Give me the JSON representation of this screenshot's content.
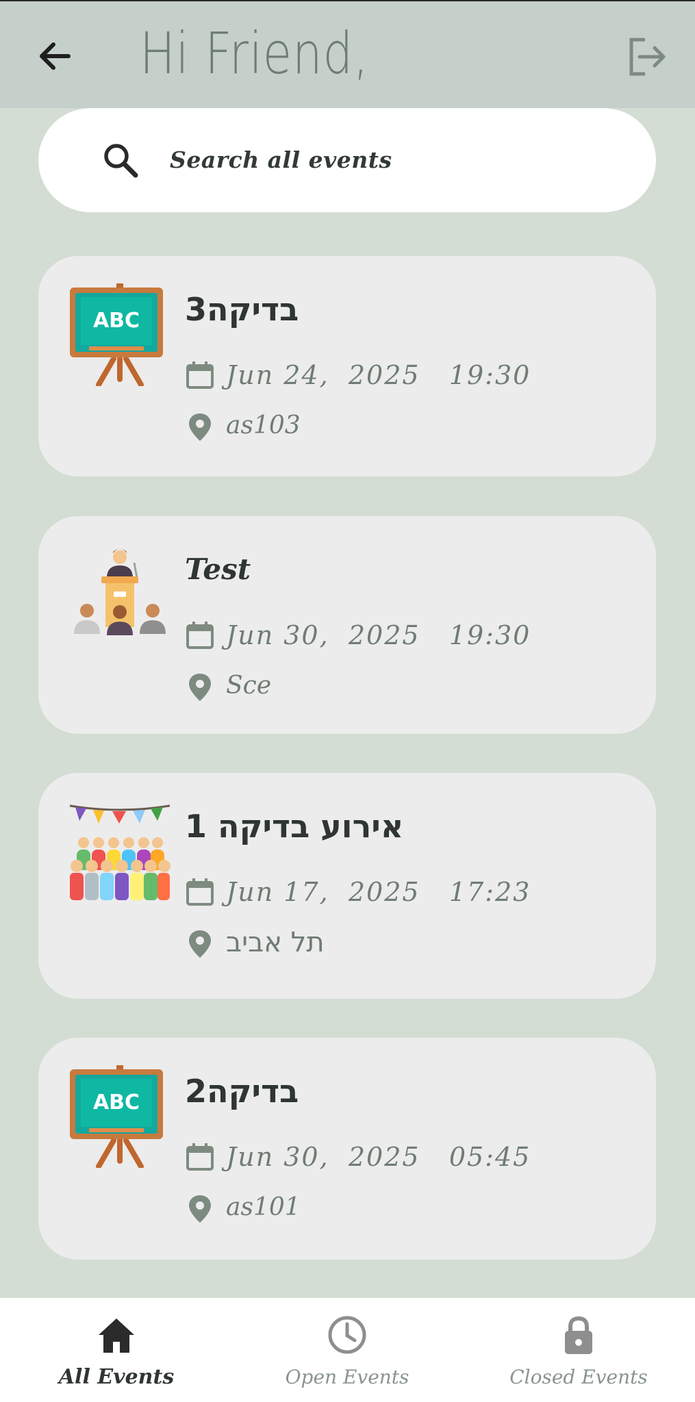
{
  "header": {
    "back_icon": "arrow-left-icon",
    "greeting": "Hi Friend,",
    "logout_icon": "logout-icon"
  },
  "search": {
    "icon": "search-icon",
    "placeholder": "Search all events"
  },
  "events": [
    {
      "icon": "chalkboard-icon",
      "title": "בדיקה3",
      "date": "Jun 24,  2025",
      "time": "19:30",
      "location": "as103"
    },
    {
      "icon": "podium-speaker-icon",
      "title": "Test",
      "date": "Jun 30,  2025",
      "time": "19:30",
      "location": "Sce"
    },
    {
      "icon": "party-crowd-icon",
      "title": "אירוע בדיקה 1",
      "date": "Jun 17,  2025",
      "time": "17:23",
      "location": "תל אביב"
    },
    {
      "icon": "chalkboard-icon",
      "title": "בדיקה2",
      "date": "Jun 30,  2025",
      "time": "05:45",
      "location": "as101"
    }
  ],
  "bottom_nav": {
    "items": [
      {
        "icon": "home-icon",
        "label": "All Events",
        "active": true
      },
      {
        "icon": "clock-icon",
        "label": "Open Events",
        "active": false
      },
      {
        "icon": "lock-icon",
        "label": "Closed Events",
        "active": false
      }
    ]
  },
  "colors": {
    "background": "#d3ddd3",
    "header": "#c6d0ca",
    "card": "#ececec",
    "muted_text": "#6f7c73"
  }
}
